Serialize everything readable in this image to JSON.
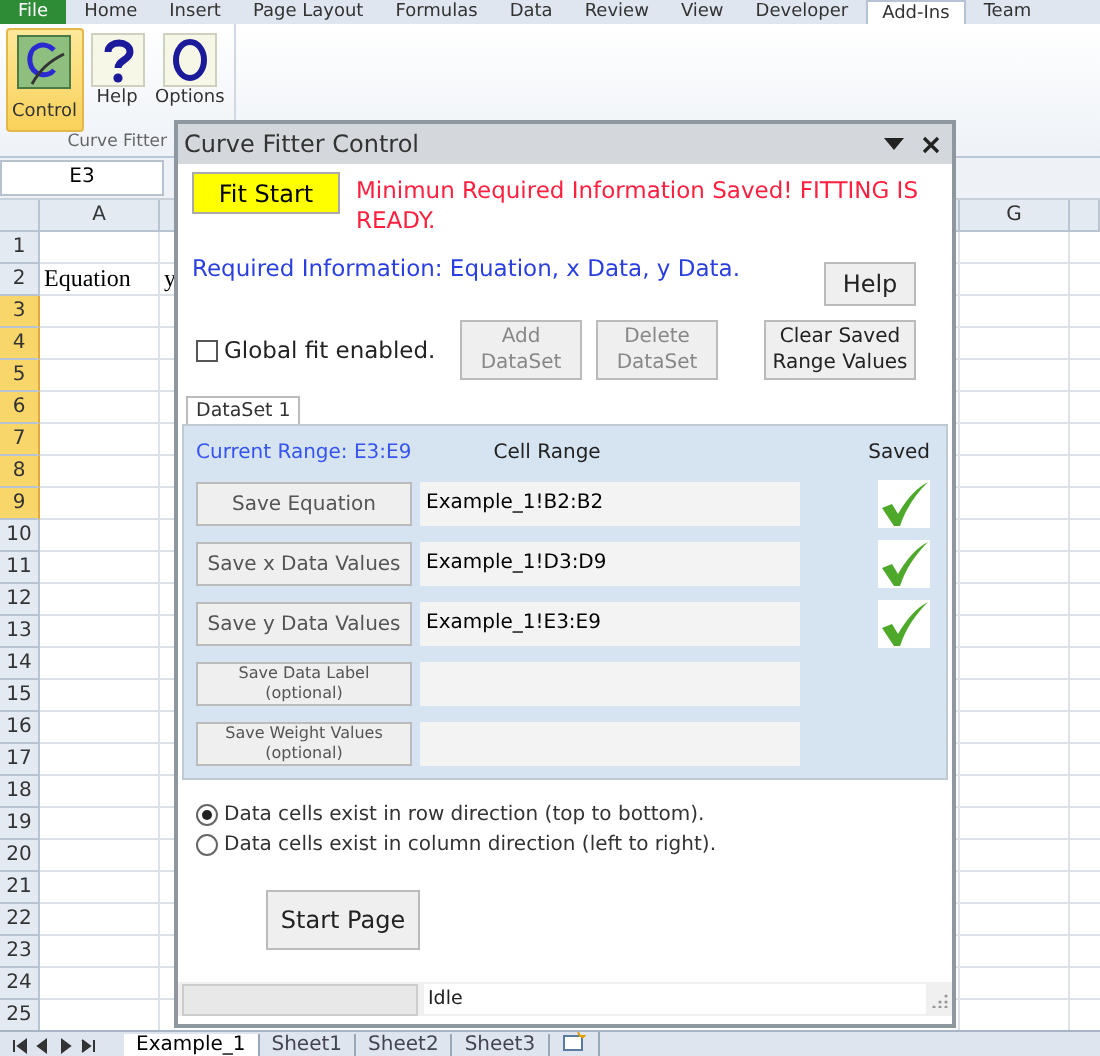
{
  "ribbon": {
    "tabs": [
      {
        "label": "File",
        "kind": "file",
        "selected": false
      },
      {
        "label": "Home",
        "kind": "tab",
        "selected": false
      },
      {
        "label": "Insert",
        "kind": "tab",
        "selected": false
      },
      {
        "label": "Page Layout",
        "kind": "tab",
        "selected": false
      },
      {
        "label": "Formulas",
        "kind": "tab",
        "selected": false
      },
      {
        "label": "Data",
        "kind": "tab",
        "selected": false
      },
      {
        "label": "Review",
        "kind": "tab",
        "selected": false
      },
      {
        "label": "View",
        "kind": "tab",
        "selected": false
      },
      {
        "label": "Developer",
        "kind": "tab",
        "selected": false
      },
      {
        "label": "Add-Ins",
        "kind": "tab",
        "selected": true
      },
      {
        "label": "Team",
        "kind": "tab",
        "selected": false
      }
    ],
    "buttons": [
      {
        "label": "Control",
        "kind": "control",
        "selected": true
      },
      {
        "label": "Help",
        "kind": "help",
        "selected": false
      },
      {
        "label": "Options",
        "kind": "options",
        "selected": false
      }
    ],
    "group_label": "Curve Fitter"
  },
  "name_box": "E3",
  "sheet": {
    "column_headers": [
      "A",
      "G"
    ],
    "rows": [
      {
        "number": "1",
        "selected": false
      },
      {
        "number": "2",
        "selected": false,
        "cell_a": "Equation",
        "cell_b": "y"
      },
      {
        "number": "3",
        "selected": true
      },
      {
        "number": "4",
        "selected": true
      },
      {
        "number": "5",
        "selected": true
      },
      {
        "number": "6",
        "selected": true
      },
      {
        "number": "7",
        "selected": true
      },
      {
        "number": "8",
        "selected": true
      },
      {
        "number": "9",
        "selected": true
      },
      {
        "number": "10",
        "selected": false
      },
      {
        "number": "11",
        "selected": false
      },
      {
        "number": "12",
        "selected": false
      },
      {
        "number": "13",
        "selected": false
      },
      {
        "number": "14",
        "selected": false
      },
      {
        "number": "15",
        "selected": false
      },
      {
        "number": "16",
        "selected": false
      },
      {
        "number": "17",
        "selected": false
      },
      {
        "number": "18",
        "selected": false
      },
      {
        "number": "19",
        "selected": false
      },
      {
        "number": "20",
        "selected": false
      },
      {
        "number": "21",
        "selected": false
      },
      {
        "number": "22",
        "selected": false
      },
      {
        "number": "23",
        "selected": false
      },
      {
        "number": "24",
        "selected": false
      },
      {
        "number": "25",
        "selected": false
      }
    ]
  },
  "dialog": {
    "title": "Curve Fitter Control",
    "fit_start_button": "Fit Start",
    "status_message": "Minimun Required Information Saved! FITTING IS READY.",
    "required_info": "Required Information: Equation, x Data, y Data.",
    "help_button": "Help",
    "global_fit": {
      "label": "Global fit enabled.",
      "checked": false
    },
    "dataset_buttons": [
      {
        "label": "Add DataSet",
        "disabled": true
      },
      {
        "label": "Delete DataSet",
        "disabled": true
      },
      {
        "label": "Clear Saved Range Values",
        "disabled": false
      }
    ],
    "tabs": [
      {
        "label": "DataSet 1",
        "selected": true
      }
    ],
    "current_range": "Current Range: E3:E9",
    "cell_range_header": "Cell Range",
    "saved_header": "Saved",
    "range_rows": [
      {
        "kind": "main",
        "label": "Save Equation",
        "range": "Example_1!B2:B2",
        "saved": true
      },
      {
        "kind": "main",
        "label": "Save x Data Values",
        "range": "Example_1!D3:D9",
        "saved": true
      },
      {
        "kind": "main",
        "label": "Save y Data Values",
        "range": "Example_1!E3:E9",
        "saved": true
      },
      {
        "kind": "optional",
        "label": "Save Data Label",
        "note": "(optional)",
        "saved": false
      },
      {
        "kind": "optional",
        "label": "Save Weight Values",
        "note": "(optional)",
        "saved": false
      }
    ],
    "direction": [
      {
        "label": "Data cells exist in row direction (top to bottom).",
        "selected": true
      },
      {
        "label": "Data cells exist in column direction (left to right).",
        "selected": false
      }
    ],
    "start_page_button": "Start Page",
    "progress": {
      "level": 0
    },
    "status_text": "Idle"
  },
  "sheet_tabs": [
    {
      "label": "Example_1",
      "selected": true
    },
    {
      "label": "Sheet1",
      "selected": false
    },
    {
      "label": "Sheet2",
      "selected": false
    },
    {
      "label": "Sheet3",
      "selected": false
    }
  ]
}
